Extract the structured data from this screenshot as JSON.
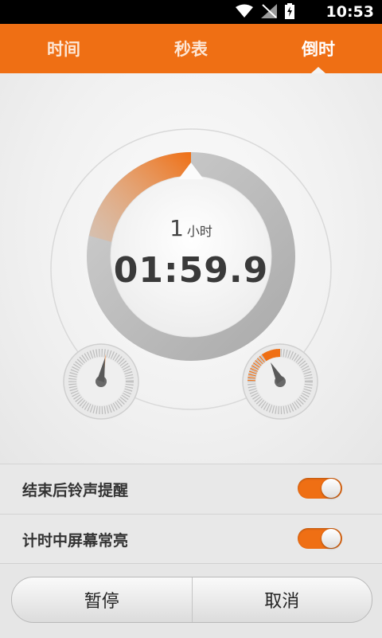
{
  "status_bar": {
    "time": "10:53",
    "icons": [
      "wifi-icon",
      "no-signal-icon",
      "battery-charging-icon"
    ]
  },
  "tabs": [
    {
      "label": "时间",
      "active": false
    },
    {
      "label": "秒表",
      "active": false
    },
    {
      "label": "倒时",
      "active": true
    }
  ],
  "timer": {
    "hours_value": "1",
    "hours_unit": "小时",
    "display": "01:59.9"
  },
  "settings": [
    {
      "label": "结束后铃声提醒",
      "enabled": true
    },
    {
      "label": "计时中屏幕常亮",
      "enabled": true
    }
  ],
  "buttons": {
    "pause": "暂停",
    "cancel": "取消"
  },
  "colors": {
    "accent": "#ef6f14",
    "ring_gray": "#c4c4c4",
    "text_dark": "#3a3a3a"
  }
}
